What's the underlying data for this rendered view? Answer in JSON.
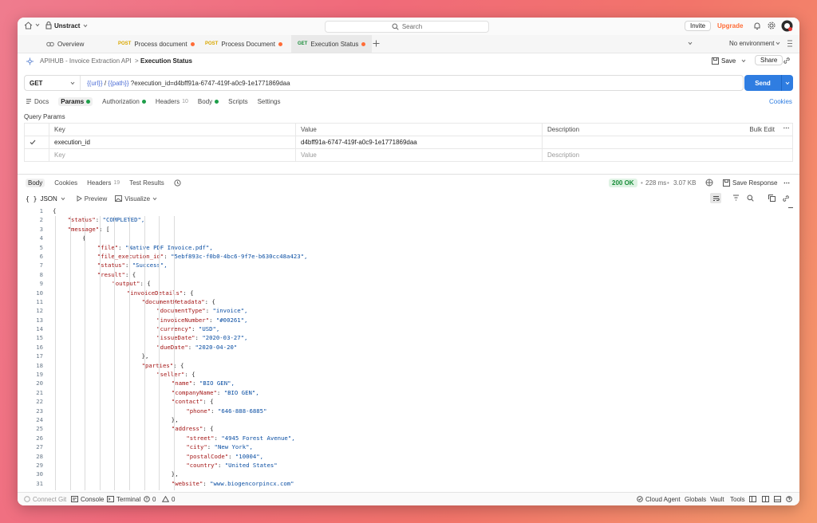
{
  "topbar": {
    "workspace": "Unstract",
    "search_placeholder": "Search",
    "invite": "Invite",
    "upgrade": "Upgrade"
  },
  "tabs": [
    {
      "label": "Overview",
      "method": ""
    },
    {
      "label": "Process document",
      "method": "POST"
    },
    {
      "label": "Process Document",
      "method": "POST"
    },
    {
      "label": "Execution Status",
      "method": "GET"
    }
  ],
  "environment": "No environment",
  "breadcrumb": {
    "collection": "APIHUB - Invoice Extraction API",
    "request": "Execution Status"
  },
  "actions": {
    "save": "Save",
    "share": "Share"
  },
  "request": {
    "method": "GET",
    "url_var1": "{{url}}",
    "url_sep": "/",
    "url_var2": "{{path}}",
    "url_rest": "?execution_id=d4bff91a-6747-419f-a0c9-1e1771869daa",
    "send": "Send"
  },
  "request_tabs": {
    "docs": "Docs",
    "params": "Params",
    "authorization": "Authorization",
    "headers": "Headers",
    "headers_count": "10",
    "body": "Body",
    "scripts": "Scripts",
    "settings": "Settings",
    "cookies": "Cookies"
  },
  "query_params": {
    "title": "Query Params",
    "col_key": "Key",
    "col_value": "Value",
    "col_description": "Description",
    "bulk_edit": "Bulk Edit",
    "row_key": "execution_id",
    "row_value": "d4bff91a-6747-419f-a0c9-1e1771869daa",
    "ph_key": "Key",
    "ph_value": "Value",
    "ph_description": "Description"
  },
  "response_tabs": {
    "body": "Body",
    "cookies": "Cookies",
    "headers": "Headers",
    "headers_count": "19",
    "test_results": "Test Results"
  },
  "response_meta": {
    "status": "200 OK",
    "time": "228 ms",
    "size": "3.07 KB",
    "save_response": "Save Response"
  },
  "view": {
    "format": "JSON",
    "preview": "Preview",
    "visualize": "Visualize"
  },
  "code_lines": [
    {
      "i": 0,
      "k": "",
      "v": "{",
      "t": "p"
    },
    {
      "i": 1,
      "k": "\"status\"",
      "v": "\"COMPLETED\",",
      "t": "s"
    },
    {
      "i": 1,
      "k": "\"message\"",
      "v": "[",
      "t": "p"
    },
    {
      "i": 2,
      "k": "",
      "v": "{",
      "t": "p"
    },
    {
      "i": 3,
      "k": "\"file\"",
      "v": "\"Native PDF Invoice.pdf\",",
      "t": "s"
    },
    {
      "i": 3,
      "k": "\"file_execution_id\"",
      "v": "\"5ebf893c-f0b0-4bc6-9f7e-b630cc48a423\",",
      "t": "s"
    },
    {
      "i": 3,
      "k": "\"status\"",
      "v": "\"Success\",",
      "t": "s"
    },
    {
      "i": 3,
      "k": "\"result\"",
      "v": "{",
      "t": "p"
    },
    {
      "i": 4,
      "k": "\"output\"",
      "v": "{",
      "t": "p"
    },
    {
      "i": 5,
      "k": "\"invoiceDetails\"",
      "v": "{",
      "t": "p"
    },
    {
      "i": 6,
      "k": "\"documentMetadata\"",
      "v": "{",
      "t": "p"
    },
    {
      "i": 7,
      "k": "\"documentType\"",
      "v": "\"invoice\",",
      "t": "s"
    },
    {
      "i": 7,
      "k": "\"invoiceNumber\"",
      "v": "\"#00261\",",
      "t": "s"
    },
    {
      "i": 7,
      "k": "\"currency\"",
      "v": "\"USD\",",
      "t": "s"
    },
    {
      "i": 7,
      "k": "\"issueDate\"",
      "v": "\"2020-03-27\",",
      "t": "s"
    },
    {
      "i": 7,
      "k": "\"dueDate\"",
      "v": "\"2020-04-20\"",
      "t": "s"
    },
    {
      "i": 6,
      "k": "",
      "v": "},",
      "t": "p"
    },
    {
      "i": 6,
      "k": "\"parties\"",
      "v": "{",
      "t": "p"
    },
    {
      "i": 7,
      "k": "\"seller\"",
      "v": "{",
      "t": "p"
    },
    {
      "i": 8,
      "k": "\"name\"",
      "v": "\"BIO GEN\",",
      "t": "s"
    },
    {
      "i": 8,
      "k": "\"companyName\"",
      "v": "\"BIO GEN\",",
      "t": "s"
    },
    {
      "i": 8,
      "k": "\"contact\"",
      "v": "{",
      "t": "p"
    },
    {
      "i": 9,
      "k": "\"phone\"",
      "v": "\"646-888-6885\"",
      "t": "s"
    },
    {
      "i": 8,
      "k": "",
      "v": "},",
      "t": "p"
    },
    {
      "i": 8,
      "k": "\"address\"",
      "v": "{",
      "t": "p"
    },
    {
      "i": 9,
      "k": "\"street\"",
      "v": "\"4945 Forest Avenue\",",
      "t": "s"
    },
    {
      "i": 9,
      "k": "\"city\"",
      "v": "\"New York\",",
      "t": "s"
    },
    {
      "i": 9,
      "k": "\"postalCode\"",
      "v": "\"10004\",",
      "t": "s"
    },
    {
      "i": 9,
      "k": "\"country\"",
      "v": "\"United States\"",
      "t": "s"
    },
    {
      "i": 8,
      "k": "",
      "v": "},",
      "t": "p"
    },
    {
      "i": 8,
      "k": "\"website\"",
      "v": "\"www.biogencorpincx.com\"",
      "t": "s"
    }
  ],
  "footer": {
    "connect_git": "Connect Git",
    "console": "Console",
    "terminal": "Terminal",
    "errors": "0",
    "warnings": "0",
    "cloud_agent": "Cloud Agent",
    "globals": "Globals",
    "vault": "Vault",
    "tools": "Tools"
  }
}
